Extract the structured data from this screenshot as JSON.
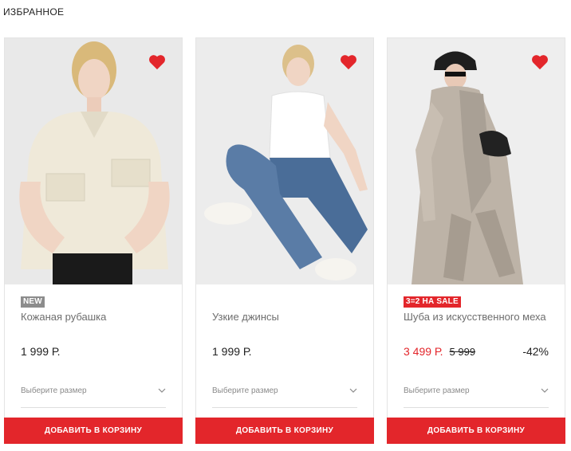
{
  "page": {
    "title": "ИЗБРАННОЕ"
  },
  "colors": {
    "accent": "#e3262b",
    "badge_new": "#8c8c8c"
  },
  "products": [
    {
      "image": "woman-in-cream-leather-shirt",
      "favorite_icon": "heart-filled-icon",
      "badge": "NEW",
      "name": "Кожаная рубашка",
      "price": "1 999 Р.",
      "size_placeholder": "Выберите размер",
      "add_to_cart": "ДОБАВИТЬ В КОРЗИНУ"
    },
    {
      "image": "woman-in-jeans-and-white-tee",
      "favorite_icon": "heart-filled-icon",
      "name": "Узкие джинсы",
      "price": "1 999 Р.",
      "size_placeholder": "Выберите размер",
      "add_to_cart": "ДОБАВИТЬ В КОРЗИНУ"
    },
    {
      "image": "woman-in-faux-fur-coat",
      "favorite_icon": "heart-filled-icon",
      "badge": "3=2 НА SALE",
      "name": "Шуба из искусственного меха",
      "price": "3 499 Р.",
      "old_price": "5 999",
      "discount": "-42%",
      "size_placeholder": "Выберите размер",
      "add_to_cart": "ДОБАВИТЬ В КОРЗИНУ"
    }
  ]
}
